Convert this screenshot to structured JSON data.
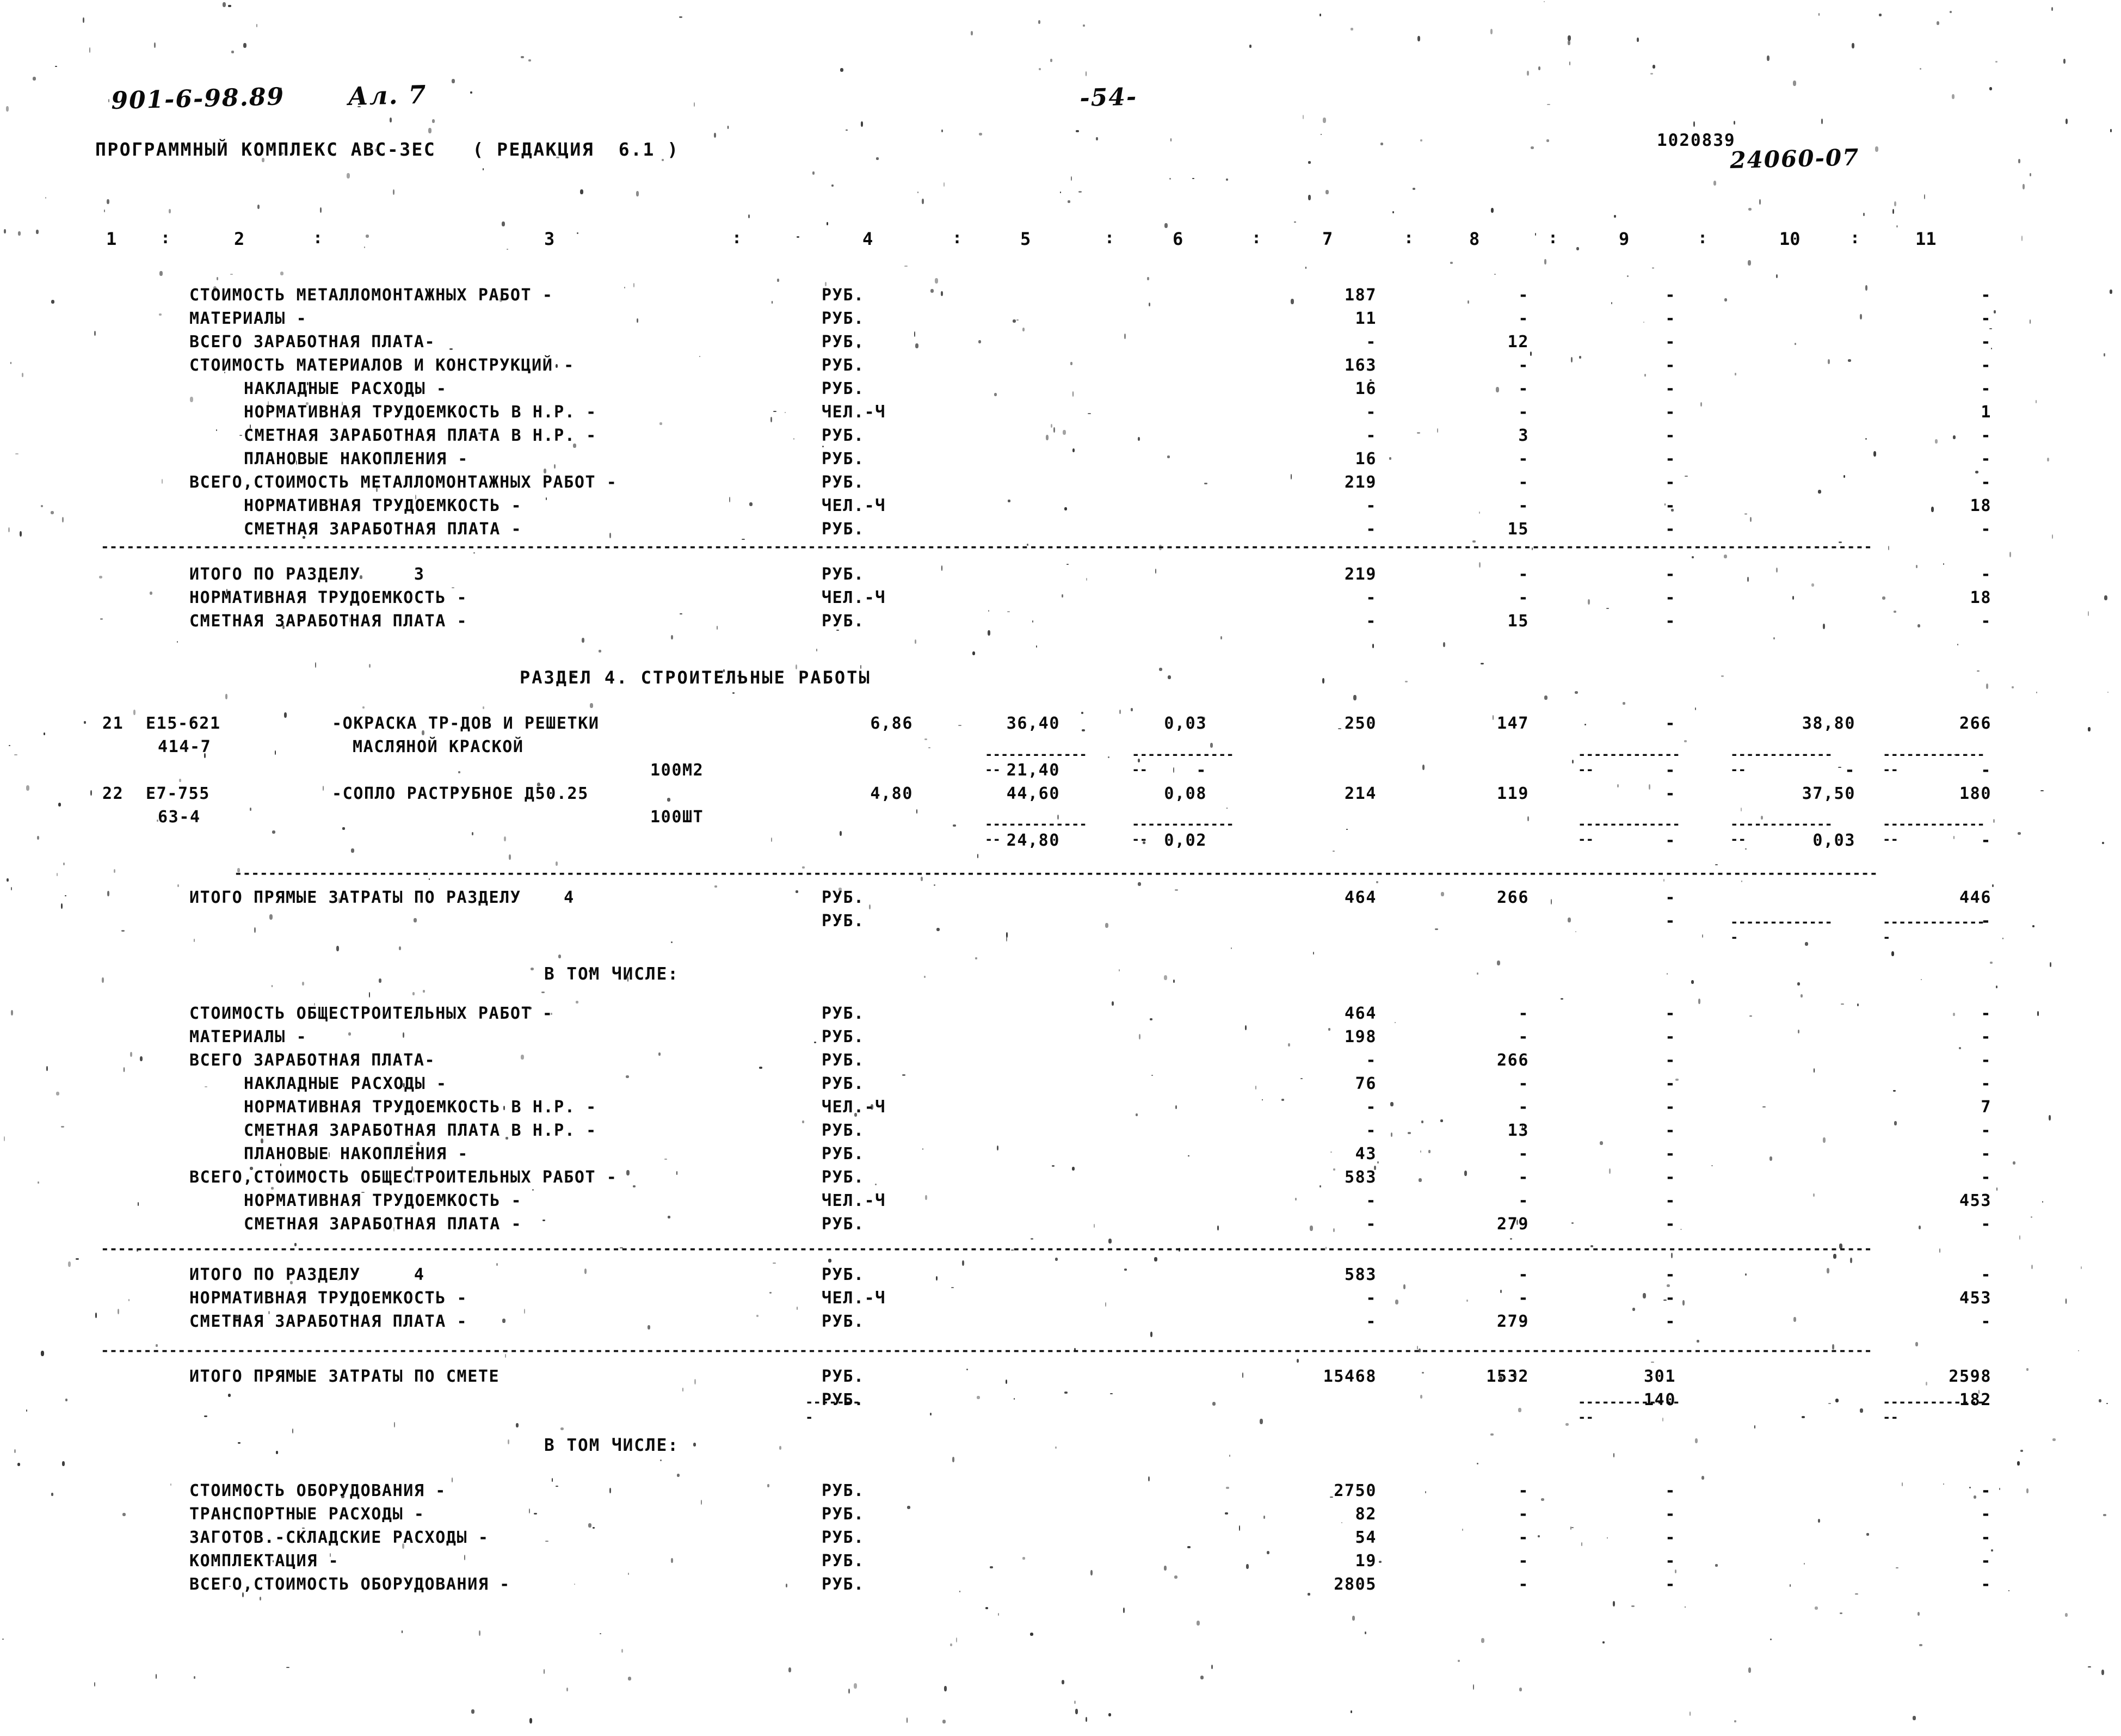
{
  "header": {
    "hand_code": "901-6-98.89",
    "hand_sheet": "Ал. 7",
    "hand_page": "-54-",
    "hand_docnum": "24060-07",
    "print_doccode": "1020839",
    "print_title": "ПРОГРАММНЫЙ КОМПЛЕКС АВС-ЗЕС   ( РЕДАКЦИЯ  6.1 )"
  },
  "columns": {
    "numbers": [
      "1",
      "2",
      "3",
      "4",
      "5",
      "6",
      "7",
      "8",
      "9",
      "10",
      "11"
    ],
    "separator": ":"
  },
  "units": {
    "rub": "РУБ.",
    "chel_ch": "ЧЕЛ.-Ч"
  },
  "dash": "-",
  "sections": {
    "v_tom_chisle": "В ТОМ ЧИСЛЕ:",
    "razdel4_title": "РАЗДЕЛ  4.  СТРОИТЕЛЬНЫЕ РАБОТЫ"
  },
  "block_metal_breakdown": [
    {
      "label": "СТОИМОСТЬ МЕТАЛЛОМОНТАЖНЫХ РАБОТ -",
      "indent": 0,
      "unit": "РУБ.",
      "c7": "187",
      "c8": "-",
      "c9": "-",
      "c10": "",
      "c11": "-"
    },
    {
      "label": "МАТЕРИАЛЫ -",
      "indent": 0,
      "unit": "РУБ.",
      "c7": "11",
      "c8": "-",
      "c9": "-",
      "c10": "",
      "c11": "-"
    },
    {
      "label": "ВСЕГО ЗАРАБОТНАЯ ПЛАТА-",
      "indent": 0,
      "unit": "РУБ.",
      "c7": "-",
      "c8": "12",
      "c9": "-",
      "c10": "",
      "c11": "-"
    },
    {
      "label": "СТОИМОСТЬ МАТЕРИАЛОВ И КОНСТРУКЦИЙ -",
      "indent": 0,
      "unit": "РУБ.",
      "c7": "163",
      "c8": "-",
      "c9": "-",
      "c10": "",
      "c11": "-"
    },
    {
      "label": "НАКЛАДНЫЕ РАСХОДЫ -",
      "indent": 1,
      "unit": "РУБ.",
      "c7": "16",
      "c8": "-",
      "c9": "-",
      "c10": "",
      "c11": "-"
    },
    {
      "label": "НОРМАТИВНАЯ ТРУДОЕМКОСТЬ В Н.Р. -",
      "indent": 1,
      "unit": "ЧЕЛ.-Ч",
      "c7": "-",
      "c8": "-",
      "c9": "-",
      "c10": "",
      "c11": "1"
    },
    {
      "label": "СМЕТНАЯ ЗАРАБОТНАЯ ПЛАТА В Н.Р. -",
      "indent": 1,
      "unit": "РУБ.",
      "c7": "-",
      "c8": "3",
      "c9": "-",
      "c10": "",
      "c11": "-"
    },
    {
      "label": "ПЛАНОВЫЕ НАКОПЛЕНИЯ -",
      "indent": 1,
      "unit": "РУБ.",
      "c7": "16",
      "c8": "-",
      "c9": "-",
      "c10": "",
      "c11": "-"
    },
    {
      "label": "ВСЕГО,СТОИМОСТЬ МЕТАЛЛОМОНТАЖНЫХ РАБОТ -",
      "indent": 0,
      "unit": "РУБ.",
      "c7": "219",
      "c8": "-",
      "c9": "-",
      "c10": "",
      "c11": "-"
    },
    {
      "label": "НОРМАТИВНАЯ ТРУДОЕМКОСТЬ -",
      "indent": 1,
      "unit": "ЧЕЛ.-Ч",
      "c7": "-",
      "c8": "-",
      "c9": "-",
      "c10": "",
      "c11": "18"
    },
    {
      "label": "СМЕТНАЯ ЗАРАБОТНАЯ ПЛАТА -",
      "indent": 1,
      "unit": "РУБ.",
      "c7": "-",
      "c8": "15",
      "c9": "-",
      "c10": "",
      "c11": "-"
    }
  ],
  "block_itogo_razdel3": [
    {
      "label": "ИТОГО ПО РАЗДЕЛУ     3",
      "indent": 0,
      "unit": "РУБ.",
      "c7": "219",
      "c8": "-",
      "c9": "-",
      "c10": "",
      "c11": "-"
    },
    {
      "label": "НОРМАТИВНАЯ ТРУДОЕМКОСТЬ -",
      "indent": 0,
      "unit": "ЧЕЛ.-Ч",
      "c7": "-",
      "c8": "-",
      "c9": "-",
      "c10": "",
      "c11": "18"
    },
    {
      "label": "СМЕТНАЯ ЗАРАБОТНАЯ ПЛАТА -",
      "indent": 0,
      "unit": "РУБ.",
      "c7": "-",
      "c8": "15",
      "c9": "-",
      "c10": "",
      "c11": "-"
    }
  ],
  "items": [
    {
      "no": "21",
      "code1": "Е15-621",
      "code2": "414-7",
      "name1": "-ОКРАСКА ТР-ДОВ И РЕШЕТКИ",
      "name2": "МАСЛЯНОЙ КРАСКОЙ",
      "measure": "100М2",
      "c4": "6,86",
      "c5": "36,40",
      "c6": "0,03",
      "c7": "250",
      "c8": "147",
      "c9": "-",
      "c10": "38,80",
      "c11": "266",
      "sub_c5": "21,40",
      "sub_c6": "-",
      "sub_c9": "",
      "sub_c10": "",
      "sub_c11": ""
    },
    {
      "no": "22",
      "code1": "Е7-755",
      "code2": "63-4",
      "name1": "-СОПЛО РАСТРУБНОЕ Д50.25",
      "name2": "",
      "measure": "100ШТ",
      "c4": "4,80",
      "c5": "44,60",
      "c6": "0,08",
      "c7": "214",
      "c8": "119",
      "c9": "-",
      "c10": "37,50",
      "c11": "180",
      "sub_c5": "24,80",
      "sub_c6": "0,02",
      "sub_c9": "-",
      "sub_c10": "0,03",
      "sub_c11": "-"
    }
  ],
  "block_pryamye_razdel4": [
    {
      "label": "ИТОГО ПРЯМЫЕ ЗАТРАТЫ ПО РАЗДЕЛУ    4",
      "indent": 0,
      "unit": "РУБ.",
      "c7": "464",
      "c8": "266",
      "c9": "-",
      "c10": "",
      "c11": "446"
    },
    {
      "label": "",
      "indent": 0,
      "unit": "РУБ.",
      "c7": "",
      "c8": "",
      "c9": "-",
      "c10": "",
      "c11": "-"
    }
  ],
  "block_common_breakdown": [
    {
      "label": "СТОИМОСТЬ ОБЩЕСТРОИТЕЛЬНЫХ РАБОТ -",
      "indent": 0,
      "unit": "РУБ.",
      "c7": "464",
      "c8": "-",
      "c9": "-",
      "c10": "",
      "c11": "-"
    },
    {
      "label": "МАТЕРИАЛЫ -",
      "indent": 0,
      "unit": "РУБ.",
      "c7": "198",
      "c8": "-",
      "c9": "-",
      "c10": "",
      "c11": "-"
    },
    {
      "label": "ВСЕГО ЗАРАБОТНАЯ ПЛАТА-",
      "indent": 0,
      "unit": "РУБ.",
      "c7": "-",
      "c8": "266",
      "c9": "-",
      "c10": "",
      "c11": "-"
    },
    {
      "label": "НАКЛАДНЫЕ РАСХОДЫ -",
      "indent": 1,
      "unit": "РУБ.",
      "c7": "76",
      "c8": "-",
      "c9": "-",
      "c10": "",
      "c11": "-"
    },
    {
      "label": "НОРМАТИВНАЯ ТРУДОЕМКОСТЬ В Н.Р. -",
      "indent": 1,
      "unit": "ЧЕЛ.-Ч",
      "c7": "-",
      "c8": "-",
      "c9": "-",
      "c10": "",
      "c11": "7"
    },
    {
      "label": "СМЕТНАЯ ЗАРАБОТНАЯ ПЛАТА В Н.Р. -",
      "indent": 1,
      "unit": "РУБ.",
      "c7": "-",
      "c8": "13",
      "c9": "-",
      "c10": "",
      "c11": "-"
    },
    {
      "label": "ПЛАНОВЫЕ НАКОПЛЕНИЯ -",
      "indent": 1,
      "unit": "РУБ.",
      "c7": "43",
      "c8": "-",
      "c9": "-",
      "c10": "",
      "c11": "-"
    },
    {
      "label": "ВСЕГО,СТОИМОСТЬ ОБЩЕСТРОИТЕЛЬНЫХ РАБОТ -",
      "indent": 0,
      "unit": "РУБ.",
      "c7": "583",
      "c8": "-",
      "c9": "-",
      "c10": "",
      "c11": "-"
    },
    {
      "label": "НОРМАТИВНАЯ ТРУДОЕМКОСТЬ -",
      "indent": 1,
      "unit": "ЧЕЛ.-Ч",
      "c7": "-",
      "c8": "-",
      "c9": "-",
      "c10": "",
      "c11": "453"
    },
    {
      "label": "СМЕТНАЯ ЗАРАБОТНАЯ ПЛАТА -",
      "indent": 1,
      "unit": "РУБ.",
      "c7": "-",
      "c8": "279",
      "c9": "-",
      "c10": "",
      "c11": "-"
    }
  ],
  "block_itogo_razdel4": [
    {
      "label": "ИТОГО ПО РАЗДЕЛУ     4",
      "indent": 0,
      "unit": "РУБ.",
      "c7": "583",
      "c8": "-",
      "c9": "-",
      "c10": "",
      "c11": "-"
    },
    {
      "label": "НОРМАТИВНАЯ ТРУДОЕМКОСТЬ -",
      "indent": 0,
      "unit": "ЧЕЛ.-Ч",
      "c7": "-",
      "c8": "-",
      "c9": "-",
      "c10": "",
      "c11": "453"
    },
    {
      "label": "СМЕТНАЯ ЗАРАБОТНАЯ ПЛАТА -",
      "indent": 0,
      "unit": "РУБ.",
      "c7": "-",
      "c8": "279",
      "c9": "-",
      "c10": "",
      "c11": "-"
    }
  ],
  "block_pryamye_smeta": [
    {
      "label": "ИТОГО ПРЯМЫЕ ЗАТРАТЫ ПО СМЕТЕ",
      "indent": 0,
      "unit": "РУБ.",
      "c7": "15468",
      "c8": "1532",
      "c9": "301",
      "c10": "",
      "c11": "2598"
    },
    {
      "label": "",
      "indent": 0,
      "unit": "РУБ.",
      "c7": "",
      "c8": "",
      "c9": "140",
      "c10": "",
      "c11": "182"
    }
  ],
  "block_equipment": [
    {
      "label": "СТОИМОСТЬ ОБОРУДОВАНИЯ -",
      "indent": 0,
      "unit": "РУБ.",
      "c7": "2750",
      "c8": "-",
      "c9": "-",
      "c10": "",
      "c11": "-"
    },
    {
      "label": "ТРАНСПОРТНЫЕ РАСХОДЫ -",
      "indent": 0,
      "unit": "РУБ.",
      "c7": "82",
      "c8": "-",
      "c9": "-",
      "c10": "",
      "c11": "-"
    },
    {
      "label": "ЗАГОТОВ.-СКЛАДСКИЕ РАСХОДЫ -",
      "indent": 0,
      "unit": "РУБ.",
      "c7": "54",
      "c8": "-",
      "c9": "-",
      "c10": "",
      "c11": "-"
    },
    {
      "label": "КОМПЛЕКТАЦИЯ -",
      "indent": 0,
      "unit": "РУБ.",
      "c7": "19",
      "c8": "-",
      "c9": "-",
      "c10": "",
      "c11": "-"
    },
    {
      "label": "ВСЕГО,СТОИМОСТЬ ОБОРУДОВАНИЯ -",
      "indent": 0,
      "unit": "РУБ.",
      "c7": "2805",
      "c8": "-",
      "c9": "-",
      "c10": "",
      "c11": "-"
    }
  ]
}
